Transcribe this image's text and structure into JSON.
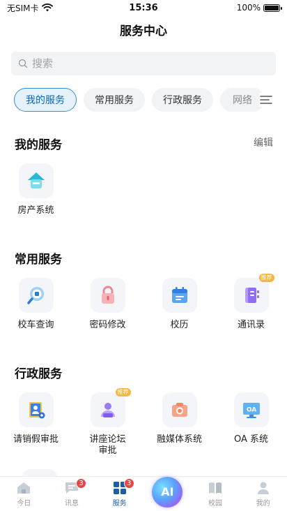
{
  "status": {
    "carrier": "无SIM卡",
    "time": "15:36",
    "battery": "100%",
    "battery_level": 1.0
  },
  "page": {
    "title": "服务中心"
  },
  "search": {
    "placeholder": "搜索"
  },
  "tabs": [
    {
      "label": "我的服务",
      "active": true
    },
    {
      "label": "常用服务",
      "active": false
    },
    {
      "label": "行政服务",
      "active": false
    },
    {
      "label": "网络",
      "active": false
    }
  ],
  "sections": {
    "my": {
      "title": "我的服务",
      "edit_label": "编辑",
      "items": [
        {
          "label": "房产系统",
          "icon": "house-icon"
        }
      ]
    },
    "common": {
      "title": "常用服务",
      "items": [
        {
          "label": "校车查询",
          "icon": "bus-search-icon"
        },
        {
          "label": "密码修改",
          "icon": "lock-icon"
        },
        {
          "label": "校历",
          "icon": "calendar-icon"
        },
        {
          "label": "通讯录",
          "icon": "contacts-icon",
          "tag": "推荐"
        }
      ]
    },
    "admin": {
      "title": "行政服务",
      "items": [
        {
          "label": "请销假审批",
          "icon": "leave-approval-icon"
        },
        {
          "label": "讲座论坛\n审批",
          "icon": "lecture-icon",
          "tag": "推荐"
        },
        {
          "label": "融媒体系统",
          "icon": "camera-icon"
        },
        {
          "label": "OA 系统",
          "icon": "oa-icon",
          "icon_text": "OA"
        }
      ]
    }
  },
  "tabbar": [
    {
      "label": "今日",
      "icon": "home-icon"
    },
    {
      "label": "讯息",
      "icon": "message-icon",
      "badge": "3"
    },
    {
      "label": "服务",
      "icon": "grid-icon",
      "badge": "3",
      "active": true
    },
    {
      "label": "",
      "icon": "ai-icon",
      "icon_text": "AI"
    },
    {
      "label": "校园",
      "icon": "book-icon"
    },
    {
      "label": "我的",
      "icon": "person-icon"
    }
  ],
  "colors": {
    "accent": "#1b5fa8",
    "active_tab_bg": "#e6f2fb",
    "active_tab_border": "#3b8bd0",
    "badge": "#e84545",
    "tag": "#f5b73d"
  }
}
